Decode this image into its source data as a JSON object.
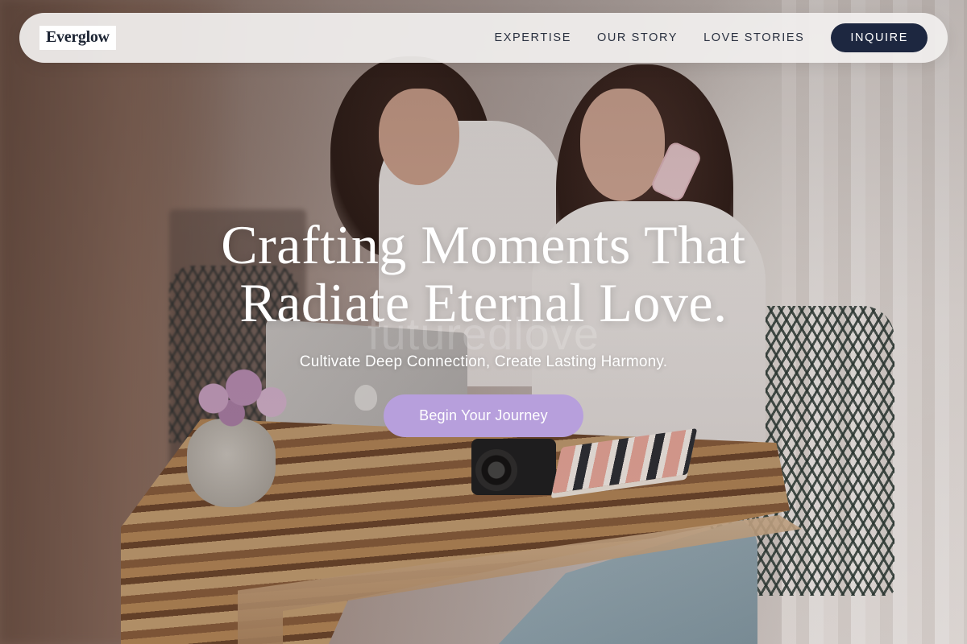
{
  "brand": {
    "logo_text": "Everglow"
  },
  "nav": {
    "links": [
      {
        "label": "EXPERTISE"
      },
      {
        "label": "OUR STORY"
      },
      {
        "label": "LOVE STORIES"
      }
    ],
    "cta_label": "INQUIRE"
  },
  "hero": {
    "title_line1": "Crafting Moments That",
    "title_line2": "Radiate Eternal Love.",
    "watermark": "futuredlove",
    "subtitle": "Cultivate Deep Connection, Create Lasting Harmony.",
    "cta_label": "Begin Your Journey"
  },
  "colors": {
    "navbar_bg": "#f1efee",
    "inquire_bg": "#1d2740",
    "cta_bg": "#b79fdc",
    "text_dark": "#2a3140"
  }
}
